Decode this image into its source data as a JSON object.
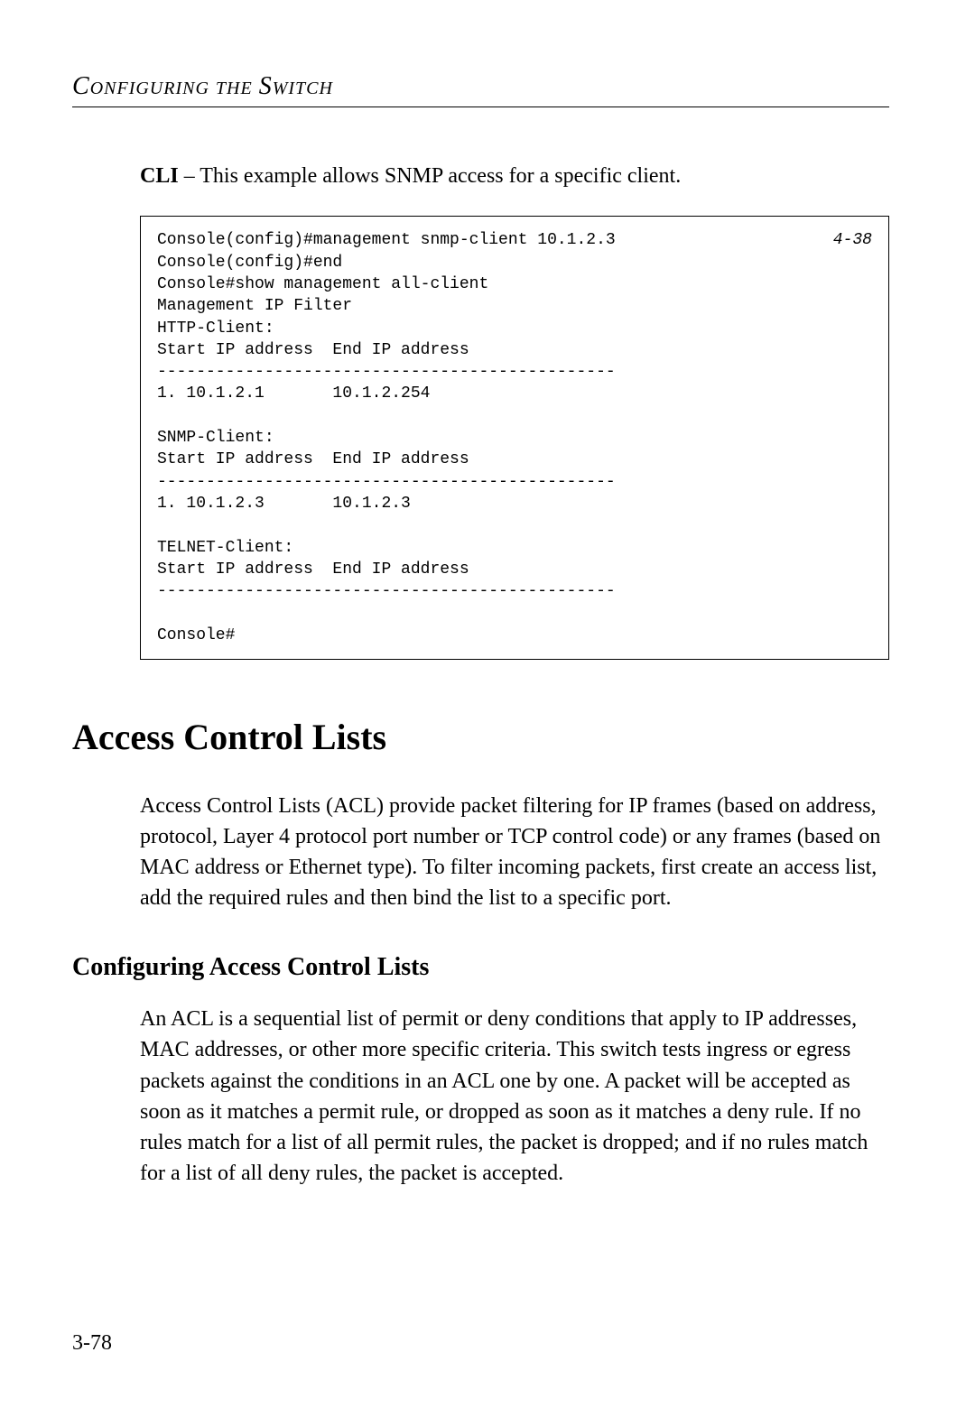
{
  "header": {
    "text": "Configuring the Switch"
  },
  "cli_intro": {
    "lead": "CLI",
    "text": " – This example allows SNMP access for a specific client."
  },
  "code": {
    "ref": "4-38",
    "line1": "Console(config)#management snmp-client 10.1.2.3",
    "rest": "Console(config)#end\nConsole#show management all-client\nManagement IP Filter\nHTTP-Client:\nStart IP address  End IP address\n-----------------------------------------------\n1. 10.1.2.1       10.1.2.254\n\nSNMP-Client:\nStart IP address  End IP address\n-----------------------------------------------\n1. 10.1.2.3       10.1.2.3\n\nTELNET-Client:\nStart IP address  End IP address\n-----------------------------------------------\n\nConsole#"
  },
  "section": {
    "h1": "Access Control Lists",
    "p1": "Access Control Lists (ACL) provide packet filtering for IP frames (based on address, protocol, Layer 4 protocol port number or TCP control code) or any frames (based on MAC address or Ethernet type). To filter incoming packets, first create an access list, add the required rules and then bind the list to a specific port.",
    "h2": "Configuring Access Control Lists",
    "p2": "An ACL is a sequential list of permit or deny conditions that apply to IP addresses, MAC addresses, or other more specific criteria. This switch tests ingress or egress packets against the conditions in an ACL one by one. A packet will be accepted as soon as it matches a permit rule, or dropped as soon as it matches a deny rule. If no rules match for a list of all permit rules, the packet is dropped; and if no rules match for a list of all deny rules, the packet is accepted."
  },
  "page_number": "3-78"
}
